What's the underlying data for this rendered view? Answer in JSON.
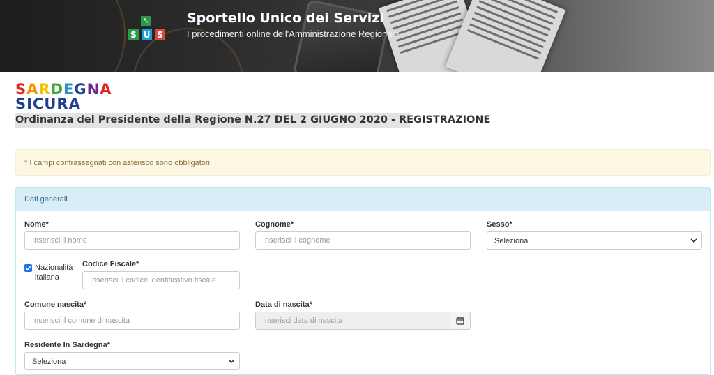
{
  "header": {
    "logo_top": "↖",
    "logo_letters": [
      "S",
      "U",
      "S"
    ],
    "logo_colors": [
      "#2c9a47",
      "#1a9fd8",
      "#e0453a"
    ],
    "title": "Sportello Unico dei Servizi",
    "subtitle": "I procedimenti online dell'Amministrazione Regionale"
  },
  "brand": {
    "line1": [
      "S",
      "A",
      "R",
      "D",
      "E",
      "G",
      "N",
      "A"
    ],
    "line1_colors": [
      "#e2231a",
      "#f39200",
      "#f6c100",
      "#3aaa35",
      "#2c8fcc",
      "#1f3f8f",
      "#6c2b8f",
      "#e2231a"
    ],
    "line2": "SICURA"
  },
  "page_title": "Ordinanza del Presidente della Regione N.27 DEL 2 GIUGNO 2020 - REGISTRAZIONE",
  "alert": "* I campi contrassegnati con asterisco sono obbligatori.",
  "panel": {
    "heading": "Dati generali",
    "nome": {
      "label": "Nome*",
      "placeholder": "Inserisci il nome"
    },
    "cognome": {
      "label": "Cognome*",
      "placeholder": "Inserisci il cognome"
    },
    "sesso": {
      "label": "Sesso*",
      "value": "Seleziona"
    },
    "nazionalita": {
      "label_line1": "Nazionalità",
      "label_line2": "italiana",
      "checked": true
    },
    "codice_fiscale": {
      "label": "Codice Fiscale*",
      "placeholder": "Inserisci il codice identificativo fiscale"
    },
    "comune_nascita": {
      "label": "Comune nascita*",
      "placeholder": "Inserisci il comune di nascita"
    },
    "data_nascita": {
      "label": "Data di nascita*",
      "placeholder": "Inserisci data di nascita"
    },
    "residente": {
      "label": "Residente In Sardegna*",
      "value": "Seleziona"
    }
  }
}
